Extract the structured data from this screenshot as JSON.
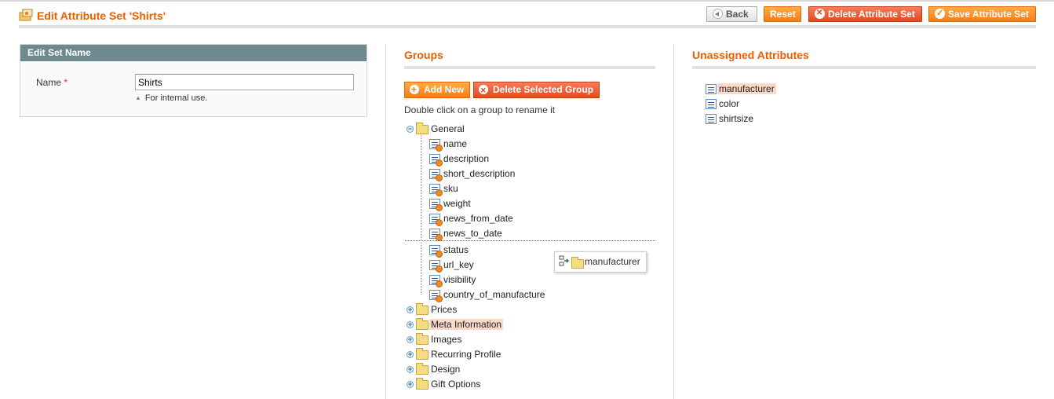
{
  "header": {
    "title": "Edit Attribute Set 'Shirts'",
    "back_label": "Back",
    "reset_label": "Reset",
    "delete_label": "Delete Attribute Set",
    "save_label": "Save Attribute Set"
  },
  "set_name": {
    "panel_title": "Edit Set Name",
    "name_label": "Name",
    "required_mark": "*",
    "name_value": "Shirts",
    "note": "For internal use."
  },
  "groups": {
    "title": "Groups",
    "add_new_label": "Add New",
    "delete_selected_label": "Delete Selected Group",
    "hint": "Double click on a group to rename it",
    "tree": [
      {
        "label": "General",
        "expanded": true,
        "children": [
          "name",
          "description",
          "short_description",
          "sku",
          "weight",
          "news_from_date",
          "news_to_date",
          "status",
          "url_key",
          "visibility",
          "country_of_manufacture"
        ]
      },
      {
        "label": "Prices",
        "expanded": false
      },
      {
        "label": "Meta Information",
        "expanded": false,
        "selected": true
      },
      {
        "label": "Images",
        "expanded": false
      },
      {
        "label": "Recurring Profile",
        "expanded": false
      },
      {
        "label": "Design",
        "expanded": false
      },
      {
        "label": "Gift Options",
        "expanded": false
      }
    ],
    "drag_item": "manufacturer"
  },
  "unassigned": {
    "title": "Unassigned Attributes",
    "items": [
      "manufacturer",
      "color",
      "shirtsize"
    ]
  },
  "colors": {
    "accent": "#eb5e00",
    "button": "#f77c16",
    "panel_header": "#6f8992",
    "selection": "#fcd8c8"
  }
}
